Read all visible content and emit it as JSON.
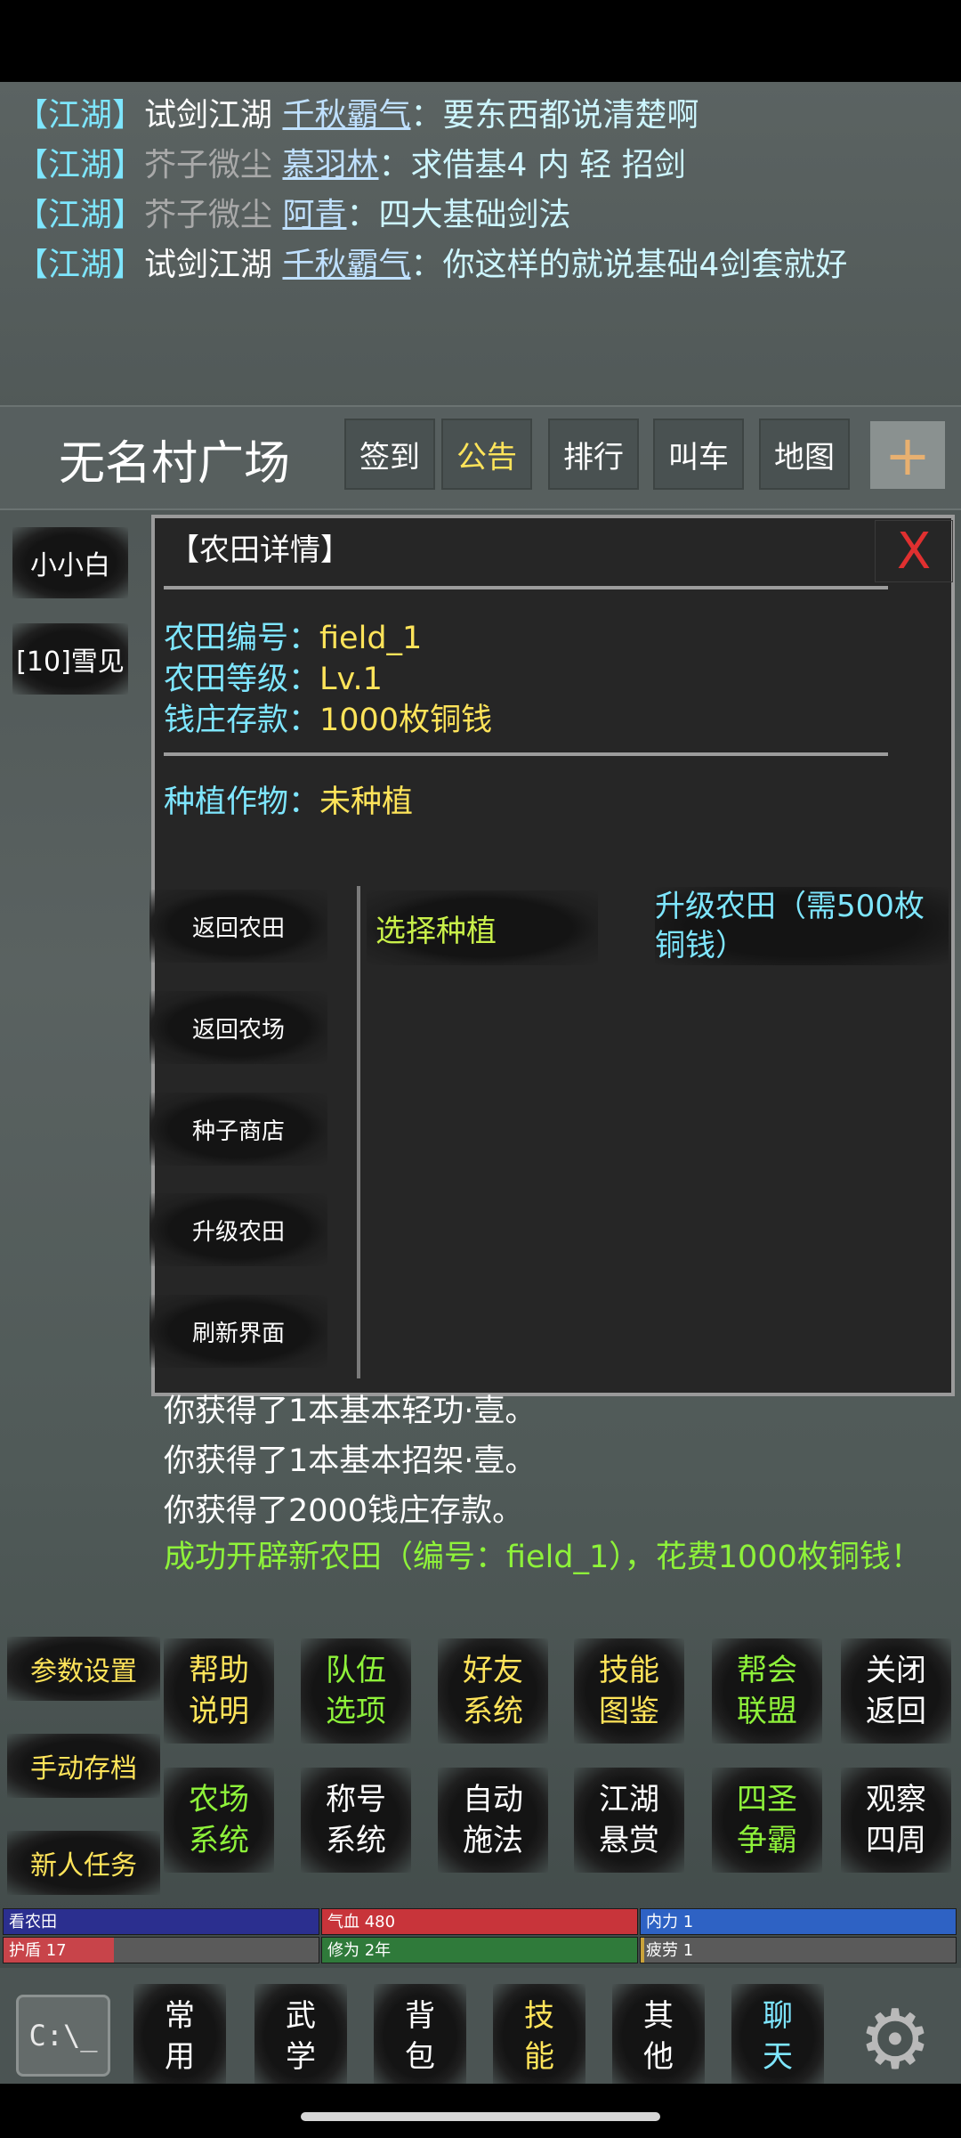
{
  "chat": [
    {
      "channel": "【江湖】",
      "source": "试剑江湖",
      "source_dim": false,
      "user": "千秋霸气",
      "sep": "：",
      "message": "要东西都说清楚啊"
    },
    {
      "channel": "【江湖】",
      "source": "芥子微尘",
      "source_dim": true,
      "user": "慕羽林",
      "sep": "：",
      "message": "求借基4  内  轻  招剑"
    },
    {
      "channel": "【江湖】",
      "source": "芥子微尘",
      "source_dim": true,
      "user": "阿青",
      "sep": "：",
      "message": "四大基础剑法"
    },
    {
      "channel": "【江湖】",
      "source": "试剑江湖",
      "source_dim": false,
      "user": "千秋霸气",
      "sep": "：",
      "message": "你这样的就说基础4剑套就好"
    }
  ],
  "header": {
    "location": "无名村广场",
    "buttons": [
      {
        "label": "签到",
        "color": "#ffffff"
      },
      {
        "label": "公告",
        "color": "#ffe45a"
      },
      {
        "label": "排行",
        "color": "#ffffff"
      },
      {
        "label": "叫车",
        "color": "#ffffff"
      },
      {
        "label": "地图",
        "color": "#ffffff"
      }
    ],
    "plus": "+"
  },
  "side_players": [
    "小小白",
    "[10]雪见"
  ],
  "dialog": {
    "title": "【农田详情】",
    "close": "X",
    "fields": [
      {
        "key": "农田编号：",
        "value": "field_1"
      },
      {
        "key": "农田等级：",
        "value": "Lv.1"
      },
      {
        "key": "钱庄存款：",
        "value": "1000枚铜钱"
      }
    ],
    "crop": {
      "key": "种植作物：",
      "value": "未种植"
    },
    "menu": [
      "返回农田",
      "返回农场",
      "种子商店",
      "升级农田",
      "刷新界面"
    ],
    "select_plant": "选择种植",
    "upgrade": "升级农田（需500枚铜钱）"
  },
  "log": [
    "你获得了1本基本轻功·壹。",
    "你获得了1本基本招架·壹。",
    "你获得了2000钱庄存款。"
  ],
  "log_success": "成功开辟新农田（编号：field_1），花费1000枚铜钱！",
  "left_buttons": [
    "参数设置",
    "手动存档",
    "新人任务"
  ],
  "grid_row1": [
    {
      "l1": "帮助",
      "l2": "说明",
      "color": "#ffe45a"
    },
    {
      "l1": "队伍",
      "l2": "选项",
      "color": "#8ef23a"
    },
    {
      "l1": "好友",
      "l2": "系统",
      "color": "#ffe45a"
    },
    {
      "l1": "技能",
      "l2": "图鉴",
      "color": "#ffe45a"
    },
    {
      "l1": "帮会",
      "l2": "联盟",
      "color": "#8ef23a"
    },
    {
      "l1": "关闭",
      "l2": "返回",
      "color": "#ffffff"
    }
  ],
  "grid_row2": [
    {
      "l1": "农场",
      "l2": "系统",
      "color": "#8ef23a"
    },
    {
      "l1": "称号",
      "l2": "系统",
      "color": "#ffffff"
    },
    {
      "l1": "自动",
      "l2": "施法",
      "color": "#ffffff"
    },
    {
      "l1": "江湖",
      "l2": "悬赏",
      "color": "#ffffff"
    },
    {
      "l1": "四圣",
      "l2": "争霸",
      "color": "#8ef23a"
    },
    {
      "l1": "观察",
      "l2": "四周",
      "color": "#ffffff"
    }
  ],
  "stats": [
    {
      "label": "看农田",
      "fill": 1.0,
      "color": "#2b2f8f"
    },
    {
      "label": "气血 480",
      "fill": 1.0,
      "color": "#c8343a"
    },
    {
      "label": "内力 1",
      "fill": 1.0,
      "color": "#2e62c4"
    },
    {
      "label": "护盾 17",
      "fill": 0.35,
      "color": "#c8444a"
    },
    {
      "label": "修为 2年",
      "fill": 1.0,
      "color": "#2f7a3a"
    },
    {
      "label": "疲劳 1",
      "fill": 0.01,
      "color": "#c9a23a"
    }
  ],
  "nav": [
    {
      "l1": "常",
      "l2": "用",
      "color": "#ffffff"
    },
    {
      "l1": "武",
      "l2": "学",
      "color": "#ffffff"
    },
    {
      "l1": "背",
      "l2": "包",
      "color": "#ffffff"
    },
    {
      "l1": "技",
      "l2": "能",
      "color": "#ffe45a"
    },
    {
      "l1": "其",
      "l2": "他",
      "color": "#ffffff"
    },
    {
      "l1": "聊",
      "l2": "天",
      "color": "#7ee6ff"
    }
  ],
  "cmd_icon": "C:\\_",
  "gear_icon": "⚙"
}
